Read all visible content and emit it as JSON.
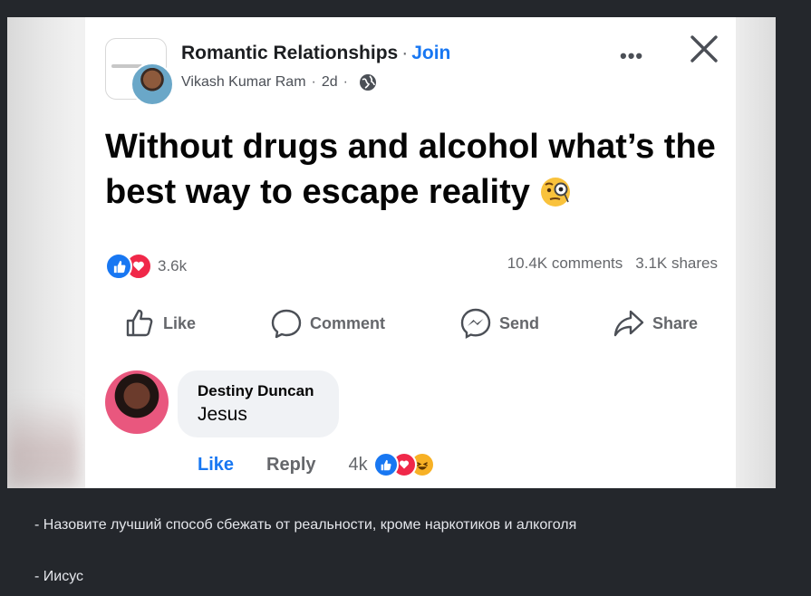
{
  "post": {
    "group_name": "Romantic Relationships",
    "join_label": "Join",
    "author": "Vikash Kumar Ram",
    "time": "2d",
    "text": "Without drugs and alcohol what’s the best way to escape reality",
    "reaction_count": "3.6k",
    "comments_count": "10.4K comments",
    "shares_count": "3.1K shares",
    "actions": {
      "like": "Like",
      "comment": "Comment",
      "send": "Send",
      "share": "Share"
    }
  },
  "comment": {
    "author": "Destiny Duncan",
    "text": "Jesus",
    "like": "Like",
    "reply": "Reply",
    "reaction_count": "4k"
  },
  "caption": {
    "line1": "- Назовите лучший способ сбежать от реальности, кроме наркотиков и алкоголя",
    "line2": "- Иисус"
  },
  "colors": {
    "accent": "#1877f2",
    "love": "#f02849",
    "haha": "#f7b125",
    "page_bg": "#24272c"
  }
}
